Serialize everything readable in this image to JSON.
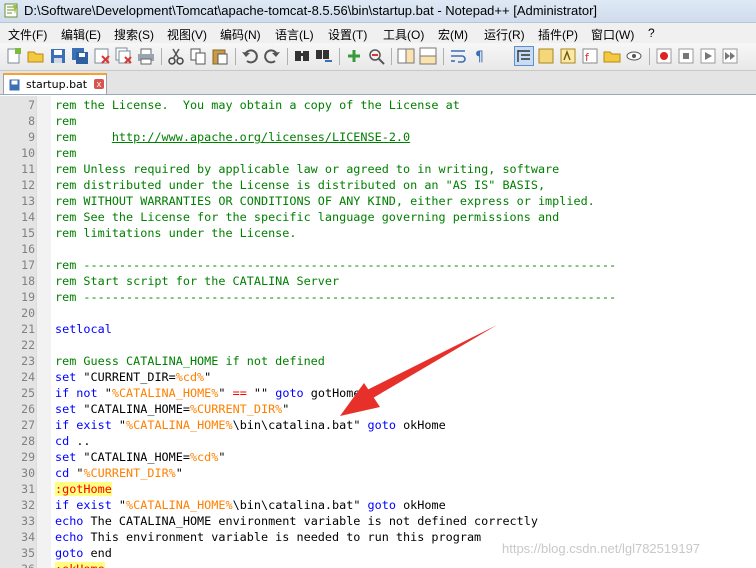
{
  "window": {
    "title": "D:\\Software\\Development\\Tomcat\\apache-tomcat-8.5.56\\bin\\startup.bat - Notepad++ [Administrator]"
  },
  "menu": [
    "文件(F)",
    "编辑(E)",
    "搜索(S)",
    "视图(V)",
    "编码(N)",
    "语言(L)",
    "设置(T)",
    "工具(O)",
    "宏(M)",
    "运行(R)",
    "插件(P)",
    "窗口(W)",
    "?"
  ],
  "tab": {
    "label": "startup.bat",
    "close": "x"
  },
  "watermark": "https://blog.csdn.net/lgl782519197",
  "colors": {
    "comment": "#008000",
    "keyword": "#0000ff",
    "variable": "#ff8000",
    "operator": "#ff0000",
    "label_bg": "#ffff80",
    "arrow": "#e8302a",
    "tab_accent": "#f7a230"
  },
  "toolbar_icons": [
    "new-file-icon",
    "open-file-icon",
    "save-icon",
    "save-all-icon",
    "close-icon",
    "close-all-icon",
    "print-icon",
    "cut-icon",
    "copy-icon",
    "paste-icon",
    "undo-icon",
    "redo-icon",
    "find-icon",
    "replace-icon",
    "zoom-in-icon",
    "zoom-out-icon",
    "sync-v-icon",
    "sync-h-icon",
    "word-wrap-icon",
    "show-all-chars-icon",
    "indent-guide-icon",
    "doc-map-icon",
    "function-list-icon",
    "folder-workspace-icon",
    "monitor-icon",
    "record-macro-icon",
    "stop-record-icon",
    "play-macro-icon",
    "play-multiple-icon",
    "save-macro-icon"
  ],
  "lines": [
    {
      "n": "7",
      "t": [
        [
          "c",
          "rem the License.  You may obtain a copy of the License at"
        ]
      ]
    },
    {
      "n": "8",
      "t": [
        [
          "c",
          "rem"
        ]
      ]
    },
    {
      "n": "9",
      "t": [
        [
          "c",
          "rem     "
        ],
        [
          "u",
          "http://www.apache.org/licenses/LICENSE-2.0"
        ]
      ]
    },
    {
      "n": "10",
      "t": [
        [
          "c",
          "rem"
        ]
      ]
    },
    {
      "n": "11",
      "t": [
        [
          "c",
          "rem Unless required by applicable law or agreed to in writing, software"
        ]
      ]
    },
    {
      "n": "12",
      "t": [
        [
          "c",
          "rem distributed under the License is distributed on an \"AS IS\" BASIS,"
        ]
      ]
    },
    {
      "n": "13",
      "t": [
        [
          "c",
          "rem WITHOUT WARRANTIES OR CONDITIONS OF ANY KIND, either express or implied."
        ]
      ]
    },
    {
      "n": "14",
      "t": [
        [
          "c",
          "rem See the License for the specific language governing permissions and"
        ]
      ]
    },
    {
      "n": "15",
      "t": [
        [
          "c",
          "rem limitations under the License."
        ]
      ]
    },
    {
      "n": "16",
      "t": []
    },
    {
      "n": "17",
      "t": [
        [
          "c",
          "rem ---------------------------------------------------------------------------"
        ]
      ]
    },
    {
      "n": "18",
      "t": [
        [
          "c",
          "rem Start script for the CATALINA Server"
        ]
      ]
    },
    {
      "n": "19",
      "t": [
        [
          "c",
          "rem ---------------------------------------------------------------------------"
        ]
      ]
    },
    {
      "n": "20",
      "t": []
    },
    {
      "n": "21",
      "t": [
        [
          "k",
          "setlocal"
        ]
      ]
    },
    {
      "n": "22",
      "t": []
    },
    {
      "n": "23",
      "t": [
        [
          "c",
          "rem Guess CATALINA_HOME if not defined"
        ]
      ]
    },
    {
      "n": "24",
      "t": [
        [
          "k",
          "set"
        ],
        [
          "x",
          " \"CURRENT_DIR="
        ],
        [
          "v",
          "%cd%"
        ],
        [
          "x",
          "\""
        ]
      ]
    },
    {
      "n": "25",
      "t": [
        [
          "k",
          "if not"
        ],
        [
          "x",
          " \""
        ],
        [
          "v",
          "%CATALINA_HOME%"
        ],
        [
          "x",
          "\" "
        ],
        [
          "o",
          "=="
        ],
        [
          "x",
          " \"\" "
        ],
        [
          "k",
          "goto"
        ],
        [
          "x",
          " gotHome"
        ]
      ]
    },
    {
      "n": "26",
      "t": [
        [
          "k",
          "set"
        ],
        [
          "x",
          " \"CATALINA_HOME="
        ],
        [
          "v",
          "%CURRENT_DIR%"
        ],
        [
          "x",
          "\""
        ]
      ]
    },
    {
      "n": "27",
      "t": [
        [
          "k",
          "if exist"
        ],
        [
          "x",
          " \""
        ],
        [
          "v",
          "%CATALINA_HOME%"
        ],
        [
          "x",
          "\\bin\\catalina.bat\" "
        ],
        [
          "k",
          "goto"
        ],
        [
          "x",
          " okHome"
        ]
      ]
    },
    {
      "n": "28",
      "t": [
        [
          "k",
          "cd"
        ],
        [
          "x",
          " .."
        ]
      ]
    },
    {
      "n": "29",
      "t": [
        [
          "k",
          "set"
        ],
        [
          "x",
          " \"CATALINA_HOME="
        ],
        [
          "v",
          "%cd%"
        ],
        [
          "x",
          "\""
        ]
      ]
    },
    {
      "n": "30",
      "t": [
        [
          "k",
          "cd"
        ],
        [
          "x",
          " \""
        ],
        [
          "v",
          "%CURRENT_DIR%"
        ],
        [
          "x",
          "\""
        ]
      ]
    },
    {
      "n": "31",
      "t": [
        [
          "l",
          ":gotHome"
        ]
      ]
    },
    {
      "n": "32",
      "t": [
        [
          "k",
          "if exist"
        ],
        [
          "x",
          " \""
        ],
        [
          "v",
          "%CATALINA_HOME%"
        ],
        [
          "x",
          "\\bin\\catalina.bat\" "
        ],
        [
          "k",
          "goto"
        ],
        [
          "x",
          " okHome"
        ]
      ]
    },
    {
      "n": "33",
      "t": [
        [
          "k",
          "echo"
        ],
        [
          "x",
          " The CATALINA_HOME environment variable is not defined correctly"
        ]
      ]
    },
    {
      "n": "34",
      "t": [
        [
          "k",
          "echo"
        ],
        [
          "x",
          " This environment variable is needed to run this program"
        ]
      ]
    },
    {
      "n": "35",
      "t": [
        [
          "k",
          "goto"
        ],
        [
          "x",
          " end"
        ]
      ]
    },
    {
      "n": "36",
      "t": [
        [
          "l",
          ":okHome"
        ]
      ]
    }
  ]
}
